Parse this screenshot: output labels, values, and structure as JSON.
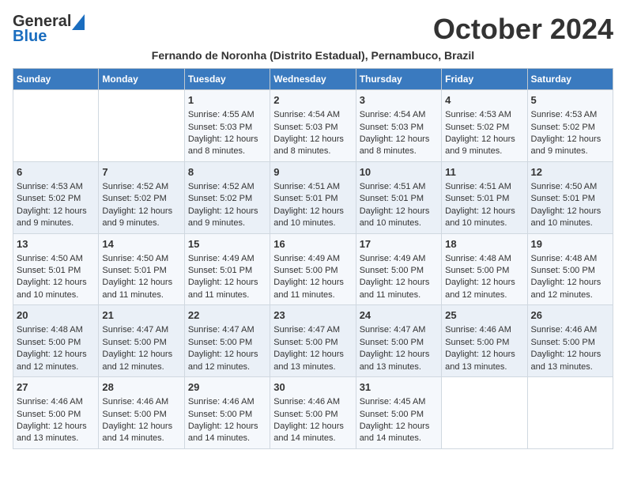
{
  "header": {
    "logo_general": "General",
    "logo_blue": "Blue",
    "month_title": "October 2024",
    "subtitle": "Fernando de Noronha (Distrito Estadual), Pernambuco, Brazil"
  },
  "weekdays": [
    "Sunday",
    "Monday",
    "Tuesday",
    "Wednesday",
    "Thursday",
    "Friday",
    "Saturday"
  ],
  "weeks": [
    [
      {
        "day": "",
        "sunrise": "",
        "sunset": "",
        "daylight": ""
      },
      {
        "day": "",
        "sunrise": "",
        "sunset": "",
        "daylight": ""
      },
      {
        "day": "1",
        "sunrise": "Sunrise: 4:55 AM",
        "sunset": "Sunset: 5:03 PM",
        "daylight": "Daylight: 12 hours and 8 minutes."
      },
      {
        "day": "2",
        "sunrise": "Sunrise: 4:54 AM",
        "sunset": "Sunset: 5:03 PM",
        "daylight": "Daylight: 12 hours and 8 minutes."
      },
      {
        "day": "3",
        "sunrise": "Sunrise: 4:54 AM",
        "sunset": "Sunset: 5:03 PM",
        "daylight": "Daylight: 12 hours and 8 minutes."
      },
      {
        "day": "4",
        "sunrise": "Sunrise: 4:53 AM",
        "sunset": "Sunset: 5:02 PM",
        "daylight": "Daylight: 12 hours and 9 minutes."
      },
      {
        "day": "5",
        "sunrise": "Sunrise: 4:53 AM",
        "sunset": "Sunset: 5:02 PM",
        "daylight": "Daylight: 12 hours and 9 minutes."
      }
    ],
    [
      {
        "day": "6",
        "sunrise": "Sunrise: 4:53 AM",
        "sunset": "Sunset: 5:02 PM",
        "daylight": "Daylight: 12 hours and 9 minutes."
      },
      {
        "day": "7",
        "sunrise": "Sunrise: 4:52 AM",
        "sunset": "Sunset: 5:02 PM",
        "daylight": "Daylight: 12 hours and 9 minutes."
      },
      {
        "day": "8",
        "sunrise": "Sunrise: 4:52 AM",
        "sunset": "Sunset: 5:02 PM",
        "daylight": "Daylight: 12 hours and 9 minutes."
      },
      {
        "day": "9",
        "sunrise": "Sunrise: 4:51 AM",
        "sunset": "Sunset: 5:01 PM",
        "daylight": "Daylight: 12 hours and 10 minutes."
      },
      {
        "day": "10",
        "sunrise": "Sunrise: 4:51 AM",
        "sunset": "Sunset: 5:01 PM",
        "daylight": "Daylight: 12 hours and 10 minutes."
      },
      {
        "day": "11",
        "sunrise": "Sunrise: 4:51 AM",
        "sunset": "Sunset: 5:01 PM",
        "daylight": "Daylight: 12 hours and 10 minutes."
      },
      {
        "day": "12",
        "sunrise": "Sunrise: 4:50 AM",
        "sunset": "Sunset: 5:01 PM",
        "daylight": "Daylight: 12 hours and 10 minutes."
      }
    ],
    [
      {
        "day": "13",
        "sunrise": "Sunrise: 4:50 AM",
        "sunset": "Sunset: 5:01 PM",
        "daylight": "Daylight: 12 hours and 10 minutes."
      },
      {
        "day": "14",
        "sunrise": "Sunrise: 4:50 AM",
        "sunset": "Sunset: 5:01 PM",
        "daylight": "Daylight: 12 hours and 11 minutes."
      },
      {
        "day": "15",
        "sunrise": "Sunrise: 4:49 AM",
        "sunset": "Sunset: 5:01 PM",
        "daylight": "Daylight: 12 hours and 11 minutes."
      },
      {
        "day": "16",
        "sunrise": "Sunrise: 4:49 AM",
        "sunset": "Sunset: 5:00 PM",
        "daylight": "Daylight: 12 hours and 11 minutes."
      },
      {
        "day": "17",
        "sunrise": "Sunrise: 4:49 AM",
        "sunset": "Sunset: 5:00 PM",
        "daylight": "Daylight: 12 hours and 11 minutes."
      },
      {
        "day": "18",
        "sunrise": "Sunrise: 4:48 AM",
        "sunset": "Sunset: 5:00 PM",
        "daylight": "Daylight: 12 hours and 12 minutes."
      },
      {
        "day": "19",
        "sunrise": "Sunrise: 4:48 AM",
        "sunset": "Sunset: 5:00 PM",
        "daylight": "Daylight: 12 hours and 12 minutes."
      }
    ],
    [
      {
        "day": "20",
        "sunrise": "Sunrise: 4:48 AM",
        "sunset": "Sunset: 5:00 PM",
        "daylight": "Daylight: 12 hours and 12 minutes."
      },
      {
        "day": "21",
        "sunrise": "Sunrise: 4:47 AM",
        "sunset": "Sunset: 5:00 PM",
        "daylight": "Daylight: 12 hours and 12 minutes."
      },
      {
        "day": "22",
        "sunrise": "Sunrise: 4:47 AM",
        "sunset": "Sunset: 5:00 PM",
        "daylight": "Daylight: 12 hours and 12 minutes."
      },
      {
        "day": "23",
        "sunrise": "Sunrise: 4:47 AM",
        "sunset": "Sunset: 5:00 PM",
        "daylight": "Daylight: 12 hours and 13 minutes."
      },
      {
        "day": "24",
        "sunrise": "Sunrise: 4:47 AM",
        "sunset": "Sunset: 5:00 PM",
        "daylight": "Daylight: 12 hours and 13 minutes."
      },
      {
        "day": "25",
        "sunrise": "Sunrise: 4:46 AM",
        "sunset": "Sunset: 5:00 PM",
        "daylight": "Daylight: 12 hours and 13 minutes."
      },
      {
        "day": "26",
        "sunrise": "Sunrise: 4:46 AM",
        "sunset": "Sunset: 5:00 PM",
        "daylight": "Daylight: 12 hours and 13 minutes."
      }
    ],
    [
      {
        "day": "27",
        "sunrise": "Sunrise: 4:46 AM",
        "sunset": "Sunset: 5:00 PM",
        "daylight": "Daylight: 12 hours and 13 minutes."
      },
      {
        "day": "28",
        "sunrise": "Sunrise: 4:46 AM",
        "sunset": "Sunset: 5:00 PM",
        "daylight": "Daylight: 12 hours and 14 minutes."
      },
      {
        "day": "29",
        "sunrise": "Sunrise: 4:46 AM",
        "sunset": "Sunset: 5:00 PM",
        "daylight": "Daylight: 12 hours and 14 minutes."
      },
      {
        "day": "30",
        "sunrise": "Sunrise: 4:46 AM",
        "sunset": "Sunset: 5:00 PM",
        "daylight": "Daylight: 12 hours and 14 minutes."
      },
      {
        "day": "31",
        "sunrise": "Sunrise: 4:45 AM",
        "sunset": "Sunset: 5:00 PM",
        "daylight": "Daylight: 12 hours and 14 minutes."
      },
      {
        "day": "",
        "sunrise": "",
        "sunset": "",
        "daylight": ""
      },
      {
        "day": "",
        "sunrise": "",
        "sunset": "",
        "daylight": ""
      }
    ]
  ]
}
